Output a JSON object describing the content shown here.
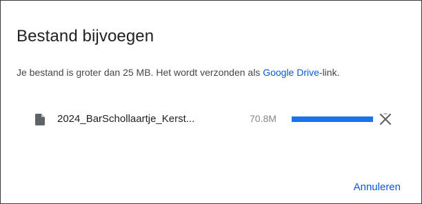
{
  "dialog": {
    "title": "Bestand bijvoegen",
    "message_before_link": "Je bestand is groter dan 25 MB. Het wordt verzonden als ",
    "message_link": "Google Drive",
    "message_after_link": "-link.",
    "cancel_label": "Annuleren"
  },
  "attachment": {
    "file_name": "2024_BarSchollaartje_Kerst...",
    "file_size": "70.8M",
    "upload_progress": 1.0,
    "icons": {
      "file": "file-icon",
      "cancel": "close-icon"
    }
  },
  "colors": {
    "link": "#0b57d0",
    "progress": "#1a73e8",
    "text": "#202124",
    "muted": "#80868b"
  }
}
